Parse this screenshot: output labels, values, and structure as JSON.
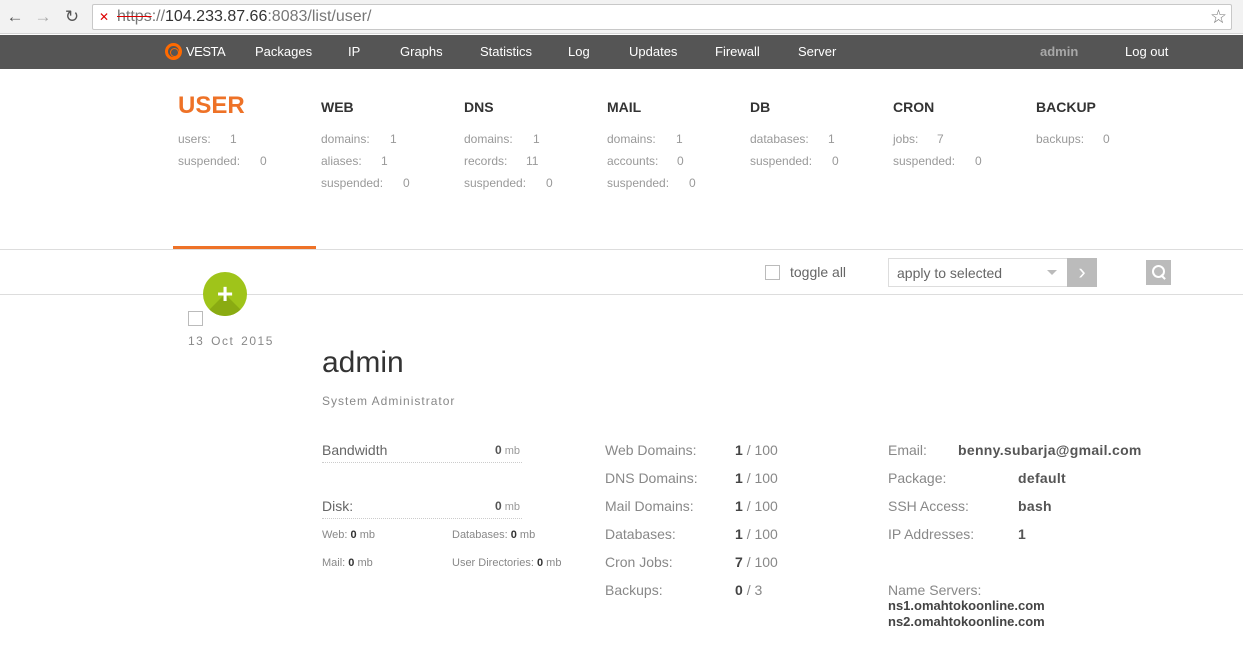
{
  "browser": {
    "url_scheme": "https",
    "url_sep": "://",
    "url_host": "104.233.87.66",
    "url_port": ":8083",
    "url_path": "/list/user/"
  },
  "nav": {
    "logo": "VESTA",
    "items": [
      "Packages",
      "IP",
      "Graphs",
      "Statistics",
      "Log",
      "Updates",
      "Firewall",
      "Server"
    ],
    "user": "admin",
    "logout": "Log out"
  },
  "sections": {
    "user": {
      "title": "USER",
      "stats": [
        [
          "users:",
          "1"
        ],
        [
          "suspended:",
          "0"
        ]
      ]
    },
    "web": {
      "title": "WEB",
      "stats": [
        [
          "domains:",
          "1"
        ],
        [
          "aliases:",
          "1"
        ],
        [
          "suspended:",
          "0"
        ]
      ]
    },
    "dns": {
      "title": "DNS",
      "stats": [
        [
          "domains:",
          "1"
        ],
        [
          "records:",
          "11"
        ],
        [
          "suspended:",
          "0"
        ]
      ]
    },
    "mail": {
      "title": "MAIL",
      "stats": [
        [
          "domains:",
          "1"
        ],
        [
          "accounts:",
          "0"
        ],
        [
          "suspended:",
          "0"
        ]
      ]
    },
    "db": {
      "title": "DB",
      "stats": [
        [
          "databases:",
          "1"
        ],
        [
          "suspended:",
          "0"
        ]
      ]
    },
    "cron": {
      "title": "CRON",
      "stats": [
        [
          "jobs:",
          "7"
        ],
        [
          "suspended:",
          "0"
        ]
      ]
    },
    "backup": {
      "title": "BACKUP",
      "stats": [
        [
          "backups:",
          "0"
        ]
      ]
    }
  },
  "toolbar": {
    "toggle_all": "toggle all",
    "apply_select": "apply to selected",
    "go": "›"
  },
  "add_button": "+",
  "user_row": {
    "date": "13 Oct 2015",
    "name": "admin",
    "role": "System Administrator",
    "bandwidth_label": "Bandwidth",
    "bandwidth_value": "0",
    "bandwidth_unit": "mb",
    "disk_label": "Disk:",
    "disk_value": "0",
    "disk_unit": "mb",
    "disk_web_label": "Web:",
    "disk_web_value": "0",
    "disk_db_label": "Databases:",
    "disk_db_value": "0",
    "disk_mail_label": "Mail:",
    "disk_mail_value": "0",
    "disk_udir_label": "User Directories:",
    "disk_udir_value": "0",
    "sub_unit": "mb",
    "limits": [
      [
        "Web Domains:",
        "1",
        "100"
      ],
      [
        "DNS Domains:",
        "1",
        "100"
      ],
      [
        "Mail Domains:",
        "1",
        "100"
      ],
      [
        "Databases:",
        "1",
        "100"
      ],
      [
        "Cron Jobs:",
        "7",
        "100"
      ],
      [
        "Backups:",
        "0",
        "3"
      ]
    ],
    "limit_sep": "/",
    "email_label": "Email:",
    "email": "benny.subarja@gmail.com",
    "package_label": "Package:",
    "package": "default",
    "ssh_label": "SSH Access:",
    "ssh": "bash",
    "ip_label": "IP Addresses:",
    "ip_count": "1",
    "ns_label": "Name Servers:",
    "ns1": "ns1.omahtokoonline.com",
    "ns2": "ns2.omahtokoonline.com"
  }
}
